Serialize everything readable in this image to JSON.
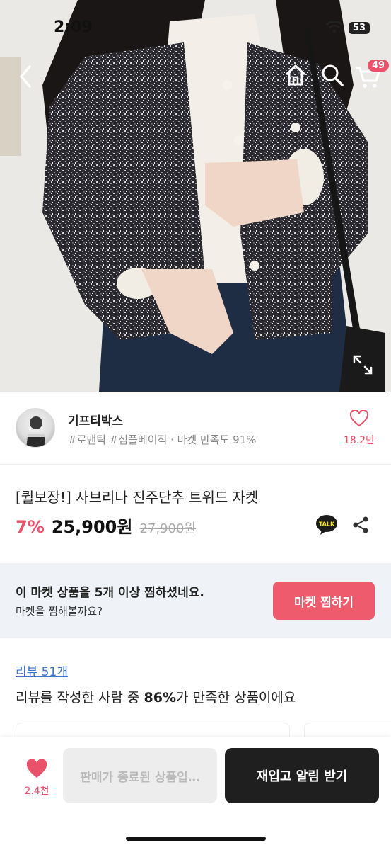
{
  "status_bar": {
    "time": "2:09",
    "battery": "53"
  },
  "top_nav": {
    "cart_count": "49"
  },
  "seller": {
    "name": "기프티박스",
    "tags": "#로맨틱 #심플베이직 · 마켓 만족도 91%",
    "likes": "18.2만"
  },
  "product": {
    "title": "[퀄보장!] 사브리나 진주단추 트위드 자켓",
    "discount": "7%",
    "price": "25,900원",
    "original_price": "27,900원",
    "talk_label": "TALK"
  },
  "banner": {
    "title": "이 마켓 상품을 5개 이상 찜하셨네요.",
    "subtitle": "마켓을 찜해볼까요?",
    "button": "마켓 찜하기"
  },
  "review": {
    "link": "리뷰 51개",
    "summary_prefix": "리뷰를 작성한 사람 중 ",
    "summary_percent": "86%",
    "summary_suffix": "가 만족한 상품이에요"
  },
  "bottom_bar": {
    "likes": "2.4천",
    "disabled_button": "판매가 종료된 상품입…",
    "restock_button": "재입고 알림 받기"
  },
  "colors": {
    "accent": "#e9526a",
    "banner_bg": "#eff3f8",
    "button_dark": "#1f1f1f",
    "link": "#3a73c9"
  }
}
